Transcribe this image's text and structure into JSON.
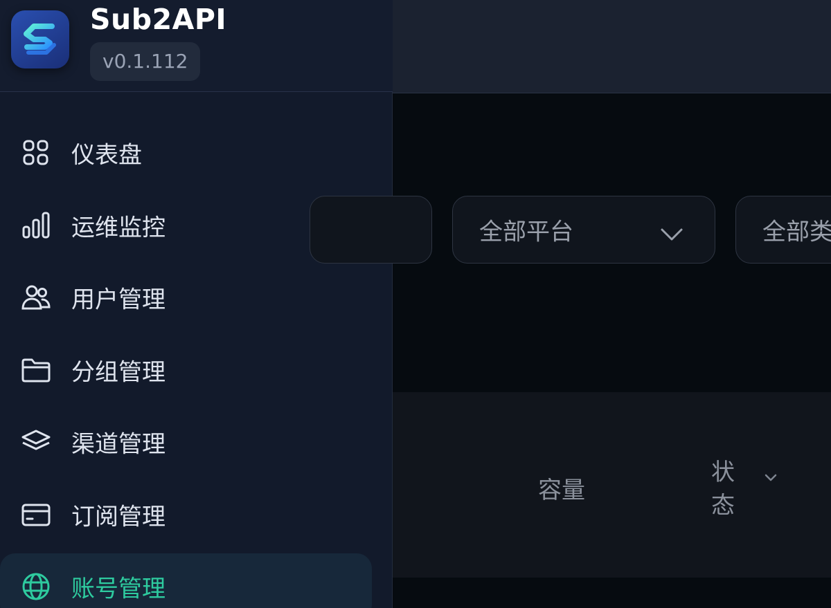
{
  "brand": {
    "app_name": "Sub2API",
    "version": "v0.1.112",
    "accent": "#2ecb9f",
    "logo_icon": "s-logo-icon"
  },
  "sidebar": {
    "items": [
      {
        "label": "仪表盘",
        "icon": "dashboard-grid-icon",
        "active": false
      },
      {
        "label": "运维监控",
        "icon": "bar-chart-icon",
        "active": false
      },
      {
        "label": "用户管理",
        "icon": "users-icon",
        "active": false
      },
      {
        "label": "分组管理",
        "icon": "folder-icon",
        "active": false
      },
      {
        "label": "渠道管理",
        "icon": "layers-icon",
        "active": false
      },
      {
        "label": "订阅管理",
        "icon": "credit-card-icon",
        "active": false
      },
      {
        "label": "账号管理",
        "icon": "globe-icon",
        "active": true
      }
    ]
  },
  "filters": {
    "platform": {
      "selected": "全部平台"
    },
    "type": {
      "selected": "全部类"
    }
  },
  "table": {
    "headers": {
      "capacity": "容量",
      "status_line1": "状",
      "status_line2": "态"
    }
  }
}
